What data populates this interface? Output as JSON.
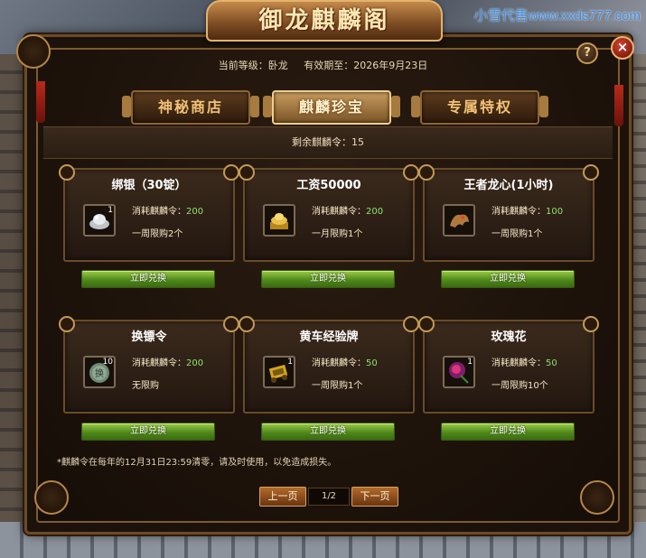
{
  "watermark": "小雪代售www.xxds777.com",
  "window": {
    "title": "御龙麒麟阁",
    "help_label": "?",
    "close_label": "×"
  },
  "info": {
    "level_label": "当前等级：卧龙",
    "expiry_label": "有效期至：2026年9月23日"
  },
  "tabs": [
    {
      "label": "神秘商店",
      "active": false
    },
    {
      "label": "麒麟珍宝",
      "active": true
    },
    {
      "label": "专属特权",
      "active": false
    }
  ],
  "remaining": "剩余麒麟令：15",
  "items": [
    {
      "title": "绑银（30锭）",
      "qty": "1",
      "cost_label": "消耗麒麟令：",
      "cost": "200",
      "limit": "一周限购2个",
      "button": "立即兑换",
      "icon": "silver-ingot-icon"
    },
    {
      "title": "工资50000",
      "qty": "",
      "cost_label": "消耗麒麟令：",
      "cost": "200",
      "limit": "一月限购1个",
      "button": "立即兑换",
      "icon": "gold-ingot-icon"
    },
    {
      "title": "王者龙心(1小时)",
      "qty": "",
      "cost_label": "消耗麒麟令：",
      "cost": "100",
      "limit": "一周限购1个",
      "button": "立即兑换",
      "icon": "dragon-heart-icon"
    },
    {
      "title": "换镖令",
      "qty": "10",
      "cost_label": "消耗麒麟令：",
      "cost": "200",
      "limit": "无限购",
      "button": "立即兑换",
      "icon": "escort-token-icon"
    },
    {
      "title": "黄车经验牌",
      "qty": "1",
      "cost_label": "消耗麒麟令：",
      "cost": "50",
      "limit": "一周限购1个",
      "button": "立即兑换",
      "icon": "yellow-cart-icon"
    },
    {
      "title": "玫瑰花",
      "qty": "1",
      "cost_label": "消耗麒麟令：",
      "cost": "50",
      "limit": "一周限购10个",
      "button": "立即兑换",
      "icon": "rose-icon"
    }
  ],
  "note": "*麒麟令在每年的12月31日23:59清零，请及时使用，以免造成损失。",
  "pager": {
    "prev": "上一页",
    "page": "1/2",
    "next": "下一页"
  }
}
